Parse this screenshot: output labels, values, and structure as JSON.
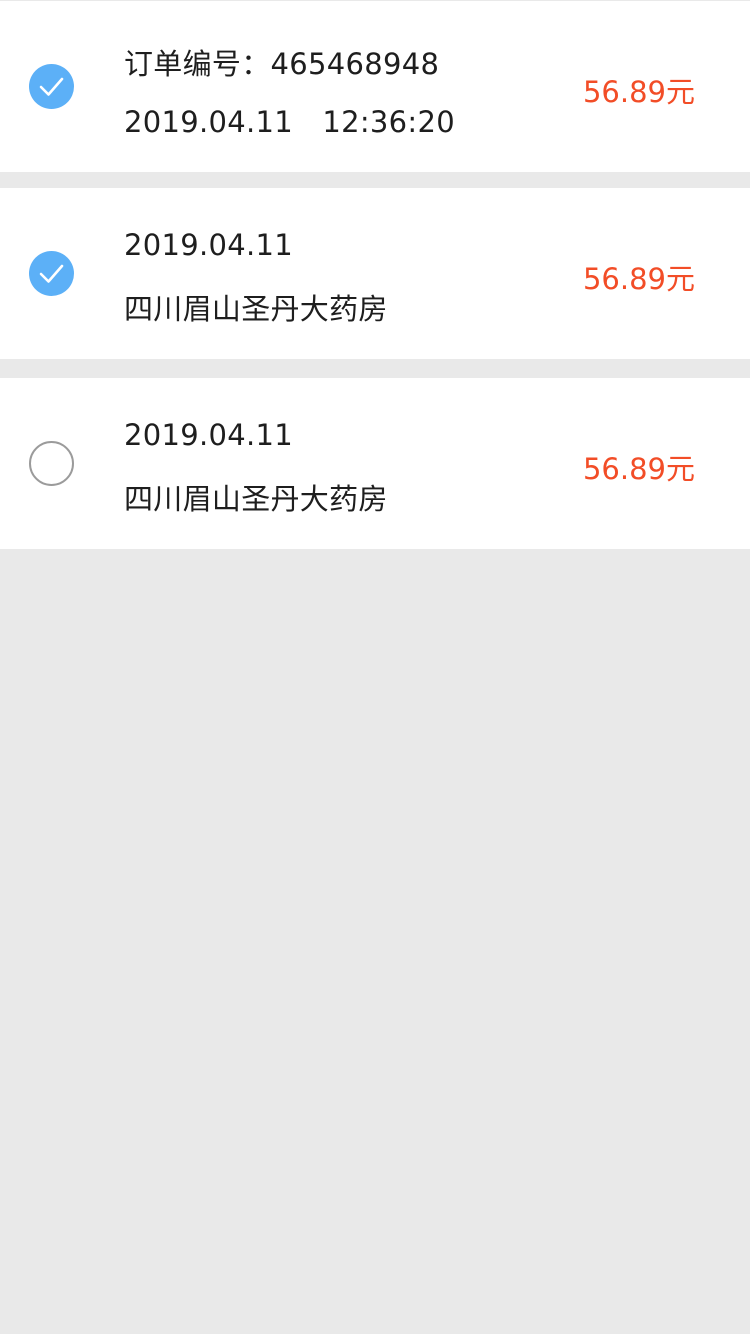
{
  "colors": {
    "background": "#e9e9e9",
    "card": "#ffffff",
    "checked": "#5cb0f7",
    "amount": "#f24d27",
    "text": "#1e1e1e",
    "unchecked_border": "#9b9b9b"
  },
  "orders": [
    {
      "checked": true,
      "checkbox_icon": "check-circle-icon",
      "line1": "订单编号：465468948",
      "line2": "2019.04.11　12:36:20",
      "amount": "56.89元"
    },
    {
      "checked": true,
      "checkbox_icon": "check-circle-icon",
      "line1": "2019.04.11",
      "line2": "四川眉山圣丹大药房",
      "amount": "56.89元"
    },
    {
      "checked": false,
      "checkbox_icon": "empty-circle-icon",
      "line1": "2019.04.11",
      "line2": "四川眉山圣丹大药房",
      "amount": "56.89元"
    }
  ]
}
